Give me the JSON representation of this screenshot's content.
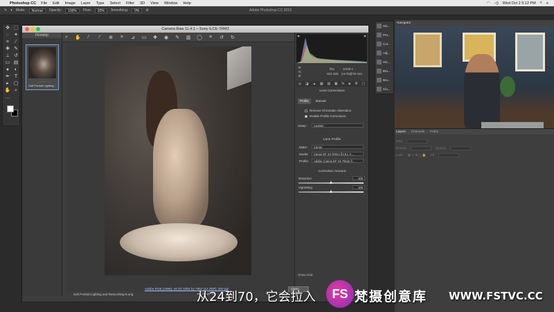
{
  "menubar": {
    "app": "Photoshop CC",
    "items": [
      "File",
      "Edit",
      "Image",
      "Layer",
      "Type",
      "Select",
      "Filter",
      "3D",
      "View",
      "Window",
      "Help"
    ],
    "datetime": "Wed Oct 2  5:12 PM"
  },
  "options": {
    "mode_label": "Mode:",
    "mode_value": "Normal",
    "opacity_label": "Opacity:",
    "opacity_value": "100%",
    "flow_label": "Flow:",
    "flow_value": "20%",
    "smoothing_label": "Smoothing:",
    "smoothing_value": "0%",
    "window_title": "Adobe Photoshop CC 2019"
  },
  "craw": {
    "title": "Camera Raw 11.4.1  –  Sony ILCE-7RM3",
    "filmstrip_label": "Filmstrip",
    "thumb_stars": "• • • • •",
    "thumb_name": "Soft Portrait Lighting...",
    "filename": "Soft Portrait Lighting and Retouching-5.orig",
    "image_count": "Image 1/1",
    "footer_link": "Adobe RGB (1998); 16 bit; 5304 by 7952 (42.2MP); 300 ppi",
    "open_label": "Open Object",
    "show_grid": "Show Grid"
  },
  "panel": {
    "exposure": "f/11",
    "shutter": "1/125 s",
    "iso": "ISO 320",
    "lens": "24-70@70 mm",
    "section_title": "Lens Corrections",
    "tabs": [
      "Profile",
      "Manual"
    ],
    "remove_ca": "Remove Chromatic Aberration",
    "enable_profile": "Enable Profile Corrections",
    "setup_label": "Setup:",
    "setup_value": "Custom",
    "lens_profile_title": "Lens Profile",
    "make_label": "Make:",
    "make_value": "Canon",
    "model_label": "Model:",
    "model_value": "Canon EF 24-70mm f/2.8 L II ...",
    "profile_label": "Profile:",
    "profile_value": "Adobe (Canon EF 24-70mm f/...",
    "correction_title": "Correction Amount",
    "distortion_label": "Distortion",
    "distortion_value": "100",
    "vignetting_label": "Vignetting",
    "vignetting_value": "100"
  },
  "dock": {
    "items": [
      "His...",
      "Pro...",
      "Col...",
      "Adj...",
      "His...",
      "Bru...",
      "Bru...",
      "Clo..."
    ]
  },
  "navigator": {
    "label": "Navigator"
  },
  "layers": {
    "tabs": [
      "Layers",
      "Channels",
      "Paths"
    ],
    "kind_label": "Kind",
    "mode_label": "Normal",
    "opacity_label": "Opacity",
    "lock_label": "Lock:",
    "fill_label": "Fill"
  },
  "subtitle": "从24到70，它会拉入",
  "watermark": {
    "logo": "FS",
    "text": "梵摄创意库",
    "url": "WWW.FSTVC.CC"
  },
  "colors": {
    "accent": "#7aa5d8",
    "brand_pink": "#e13c9a"
  }
}
